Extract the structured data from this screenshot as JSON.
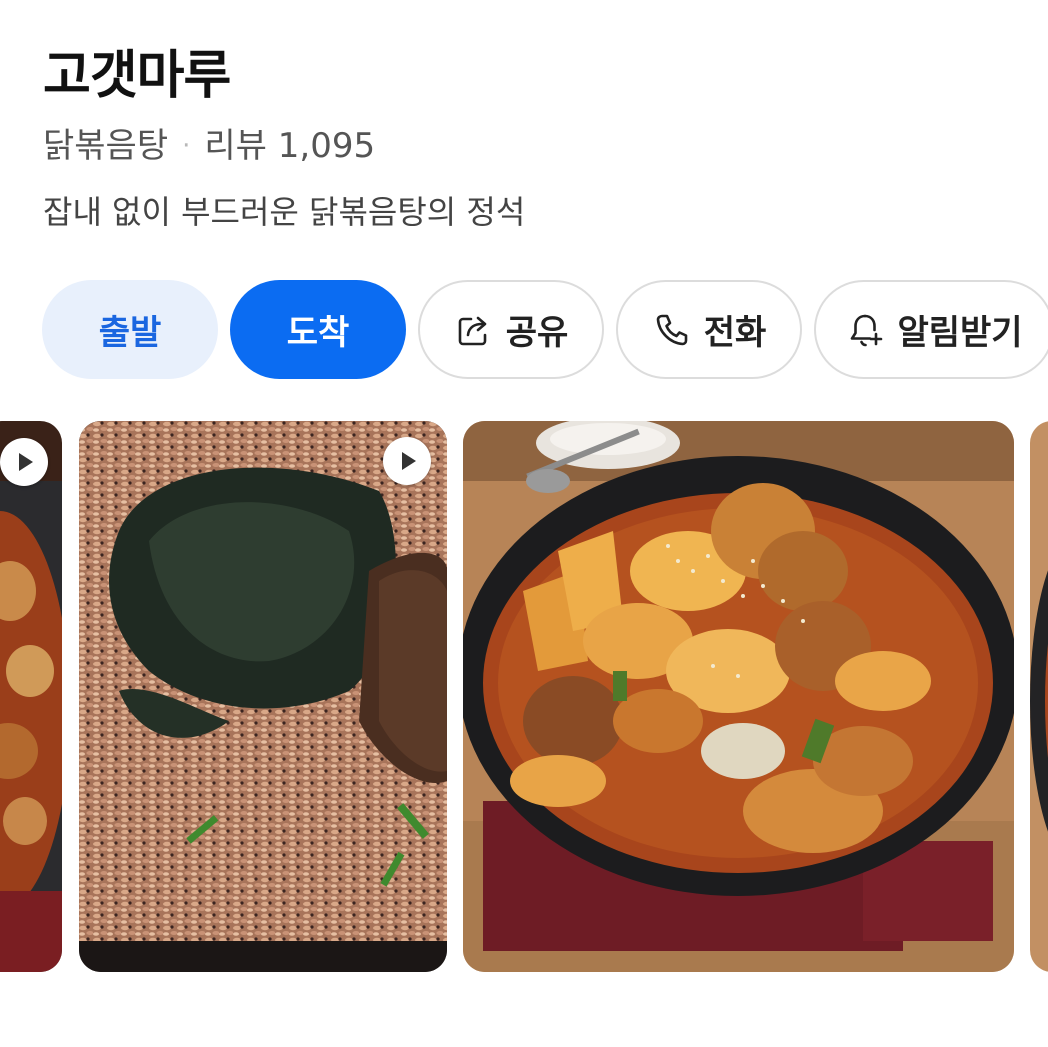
{
  "place": {
    "name": "고갯마루",
    "category": "닭볶음탕",
    "separator": "·",
    "reviews_label": "리뷰 1,095",
    "description": "잡내 없이 부드러운 닭볶음탕의 정석"
  },
  "actions": {
    "depart": "출발",
    "arrive": "도착",
    "share": "공유",
    "call": "전화",
    "notify": "알림받기"
  },
  "icons": {
    "share": "share-icon",
    "call": "phone-icon",
    "notify": "bell-plus-icon",
    "play": "play-icon"
  },
  "colors": {
    "primary": "#0b6cf2",
    "primary_light": "#e8f0fc",
    "primary_text": "#1a66e0"
  },
  "photos": [
    {
      "id": "photo-1",
      "video": true
    },
    {
      "id": "photo-2",
      "video": true
    },
    {
      "id": "photo-3",
      "video": false
    },
    {
      "id": "photo-4",
      "video": false
    }
  ]
}
